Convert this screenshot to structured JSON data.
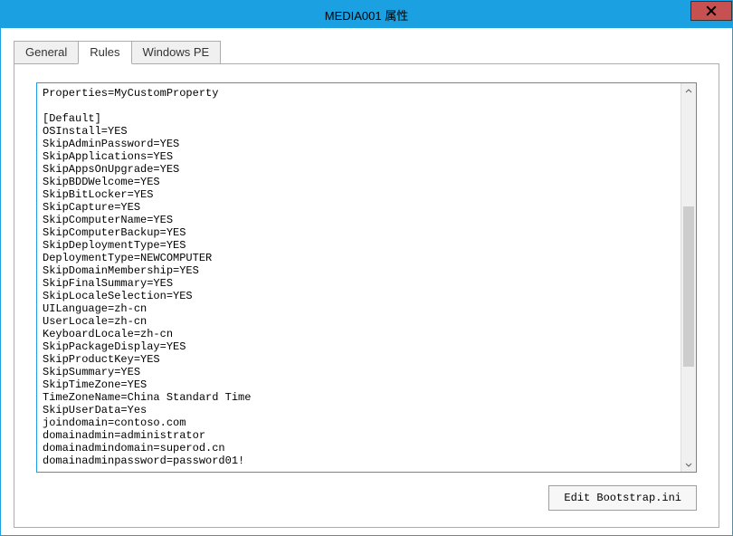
{
  "window": {
    "title": "MEDIA001 属性"
  },
  "tabs": {
    "general": "General",
    "rules": "Rules",
    "windowspe": "Windows PE",
    "active": "rules"
  },
  "rules": {
    "text": "Properties=MyCustomProperty\n\n[Default]\nOSInstall=YES\nSkipAdminPassword=YES\nSkipApplications=YES\nSkipAppsOnUpgrade=YES\nSkipBDDWelcome=YES\nSkipBitLocker=YES\nSkipCapture=YES\nSkipComputerName=YES\nSkipComputerBackup=YES\nSkipDeploymentType=YES\nDeploymentType=NEWCOMPUTER\nSkipDomainMembership=YES\nSkipFinalSummary=YES\nSkipLocaleSelection=YES\nUILanguage=zh-cn\nUserLocale=zh-cn\nKeyboardLocale=zh-cn\nSkipPackageDisplay=YES\nSkipProductKey=YES\nSkipSummary=YES\nSkipTimeZone=YES\nTimeZoneName=China Standard Time\nSkipUserData=Yes\njoindomain=contoso.com\ndomainadmin=administrator\ndomainadmindomain=superod.cn\ndomainadminpassword=password01!"
  },
  "buttons": {
    "editBootstrap": "Edit Bootstrap.ini"
  }
}
